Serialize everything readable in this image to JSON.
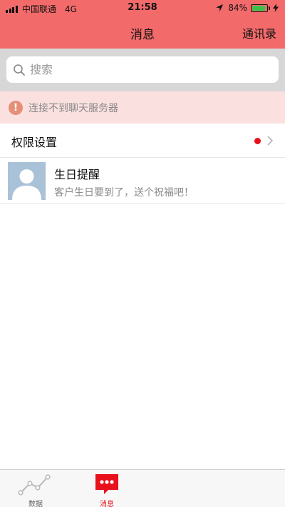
{
  "status_bar": {
    "carrier": "中国联通",
    "network": "4G",
    "time": "21:58",
    "battery_percent": "84%",
    "battery_level": 0.84
  },
  "nav": {
    "title": "消息",
    "contacts_label": "通讯录"
  },
  "search": {
    "placeholder": "搜索"
  },
  "warning": {
    "text": "连接不到聊天服务器"
  },
  "permissions": {
    "label": "权限设置"
  },
  "messages": [
    {
      "title": "生日提醒",
      "subtitle": "客户生日要到了，送个祝福吧！"
    }
  ],
  "tabs": [
    {
      "label": "数据",
      "icon": "line-chart-icon",
      "active": false
    },
    {
      "label": "消息",
      "icon": "chat-bubble-icon",
      "active": true
    }
  ],
  "colors": {
    "header": "#f36a6a",
    "accent_red": "#e8101a",
    "warning_bg": "#fbe0e0"
  }
}
